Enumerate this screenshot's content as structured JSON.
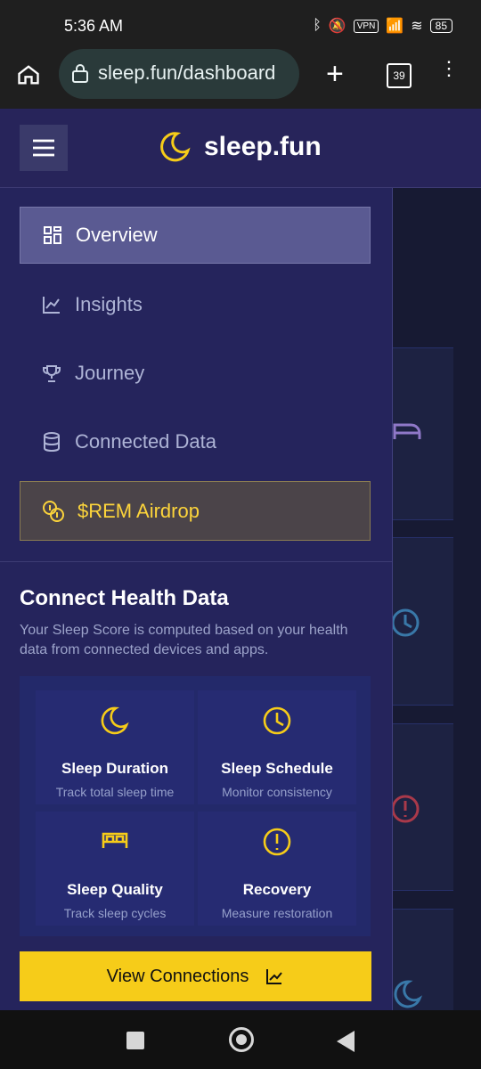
{
  "status_bar": {
    "time": "5:36 AM",
    "vpn": "VPN",
    "battery": "85"
  },
  "browser": {
    "url": "sleep.fun/dashboard",
    "tab_count": "39"
  },
  "app": {
    "brand": "sleep.fun"
  },
  "nav": [
    {
      "label": "Overview"
    },
    {
      "label": "Insights"
    },
    {
      "label": "Journey"
    },
    {
      "label": "Connected Data"
    },
    {
      "label": "$REM Airdrop"
    }
  ],
  "section": {
    "title": "Connect Health Data",
    "description": "Your Sleep Score is computed based on your health data from connected devices and apps."
  },
  "tiles": [
    {
      "title": "Sleep Duration",
      "subtitle": "Track total sleep time",
      "icon": "moon-icon"
    },
    {
      "title": "Sleep Schedule",
      "subtitle": "Monitor consistency",
      "icon": "clock-icon"
    },
    {
      "title": "Sleep Quality",
      "subtitle": "Track sleep cycles",
      "icon": "bed-icon"
    },
    {
      "title": "Recovery",
      "subtitle": "Measure restoration",
      "icon": "alert-circle-icon"
    }
  ],
  "cta": {
    "label": "View Connections"
  },
  "colors": {
    "accent": "#f6cc19",
    "drawer_bg": "#25245c",
    "active_item": "#5a5a92"
  }
}
